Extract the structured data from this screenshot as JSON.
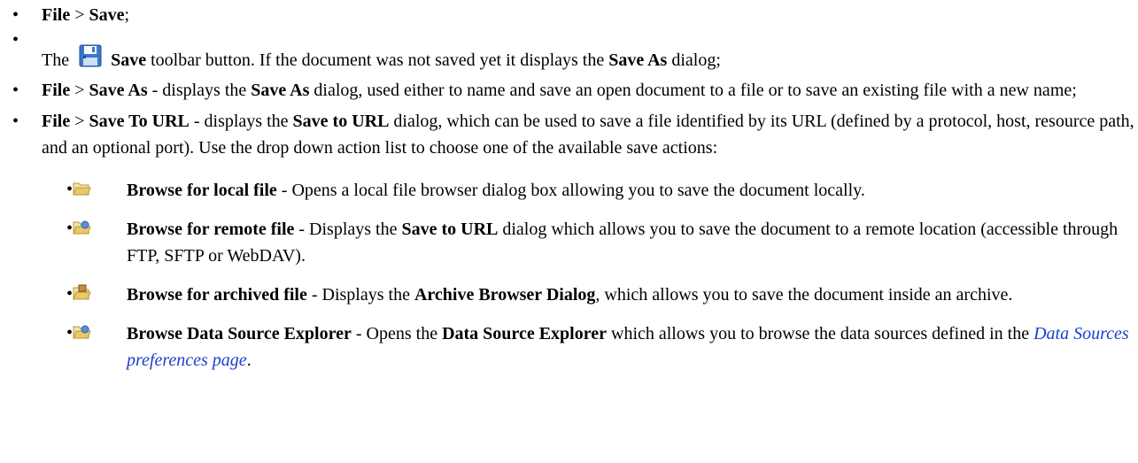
{
  "items": {
    "i1": {
      "a": "File",
      "b": " > ",
      "c": "Save",
      "d": ";"
    },
    "i2": {
      "a": "The ",
      "b": "Save",
      "c": " toolbar button. If the document was not saved yet it displays the ",
      "d": "Save As",
      "e": " dialog;"
    },
    "i3": {
      "a": "File",
      "b": " > ",
      "c": "Save As",
      "d": " - displays the ",
      "e": "Save As",
      "f": " dialog, used either to name and save an open document to a file or to save an existing file with a new name;"
    },
    "i4": {
      "a": "File",
      "b": " > ",
      "c": "Save To URL",
      "d": " - displays the ",
      "e": "Save to URL",
      "f": " dialog, which can be used to save a file identified by its URL (defined by a protocol, host, resource path, and an optional port). Use the drop down action list to choose one of the available save actions:"
    }
  },
  "sub": {
    "s1": {
      "a": "Browse for local file",
      "b": " - Opens a local file browser dialog box allowing you to save the document locally."
    },
    "s2": {
      "a": "Browse for remote file",
      "b": " - Displays the ",
      "c": "Save to URL",
      "d": " dialog which allows you to save the document to a remote location (accessible through FTP, SFTP or WebDAV)."
    },
    "s3": {
      "a": "Browse for archived file",
      "b": " - Displays the ",
      "c": "Archive Browser Dialog",
      "d": ", which allows you to save the document inside an archive."
    },
    "s4": {
      "a": "Browse Data Source Explorer",
      "b": " - Opens the ",
      "c": "Data Source Explorer",
      "d": " which allows you to browse the data sources defined in the ",
      "e": "Data Sources preferences page",
      "f": "."
    }
  },
  "bullet": "•",
  "icons": {
    "save": "floppy-disk-icon",
    "local": "folder-icon",
    "remote": "folder-remote-icon",
    "archive": "folder-archive-icon",
    "datasource": "folder-datasource-icon"
  },
  "colors": {
    "link": "#1a3fd0",
    "icon_blue": "#3a78c9",
    "folder": "#e8c96a"
  }
}
